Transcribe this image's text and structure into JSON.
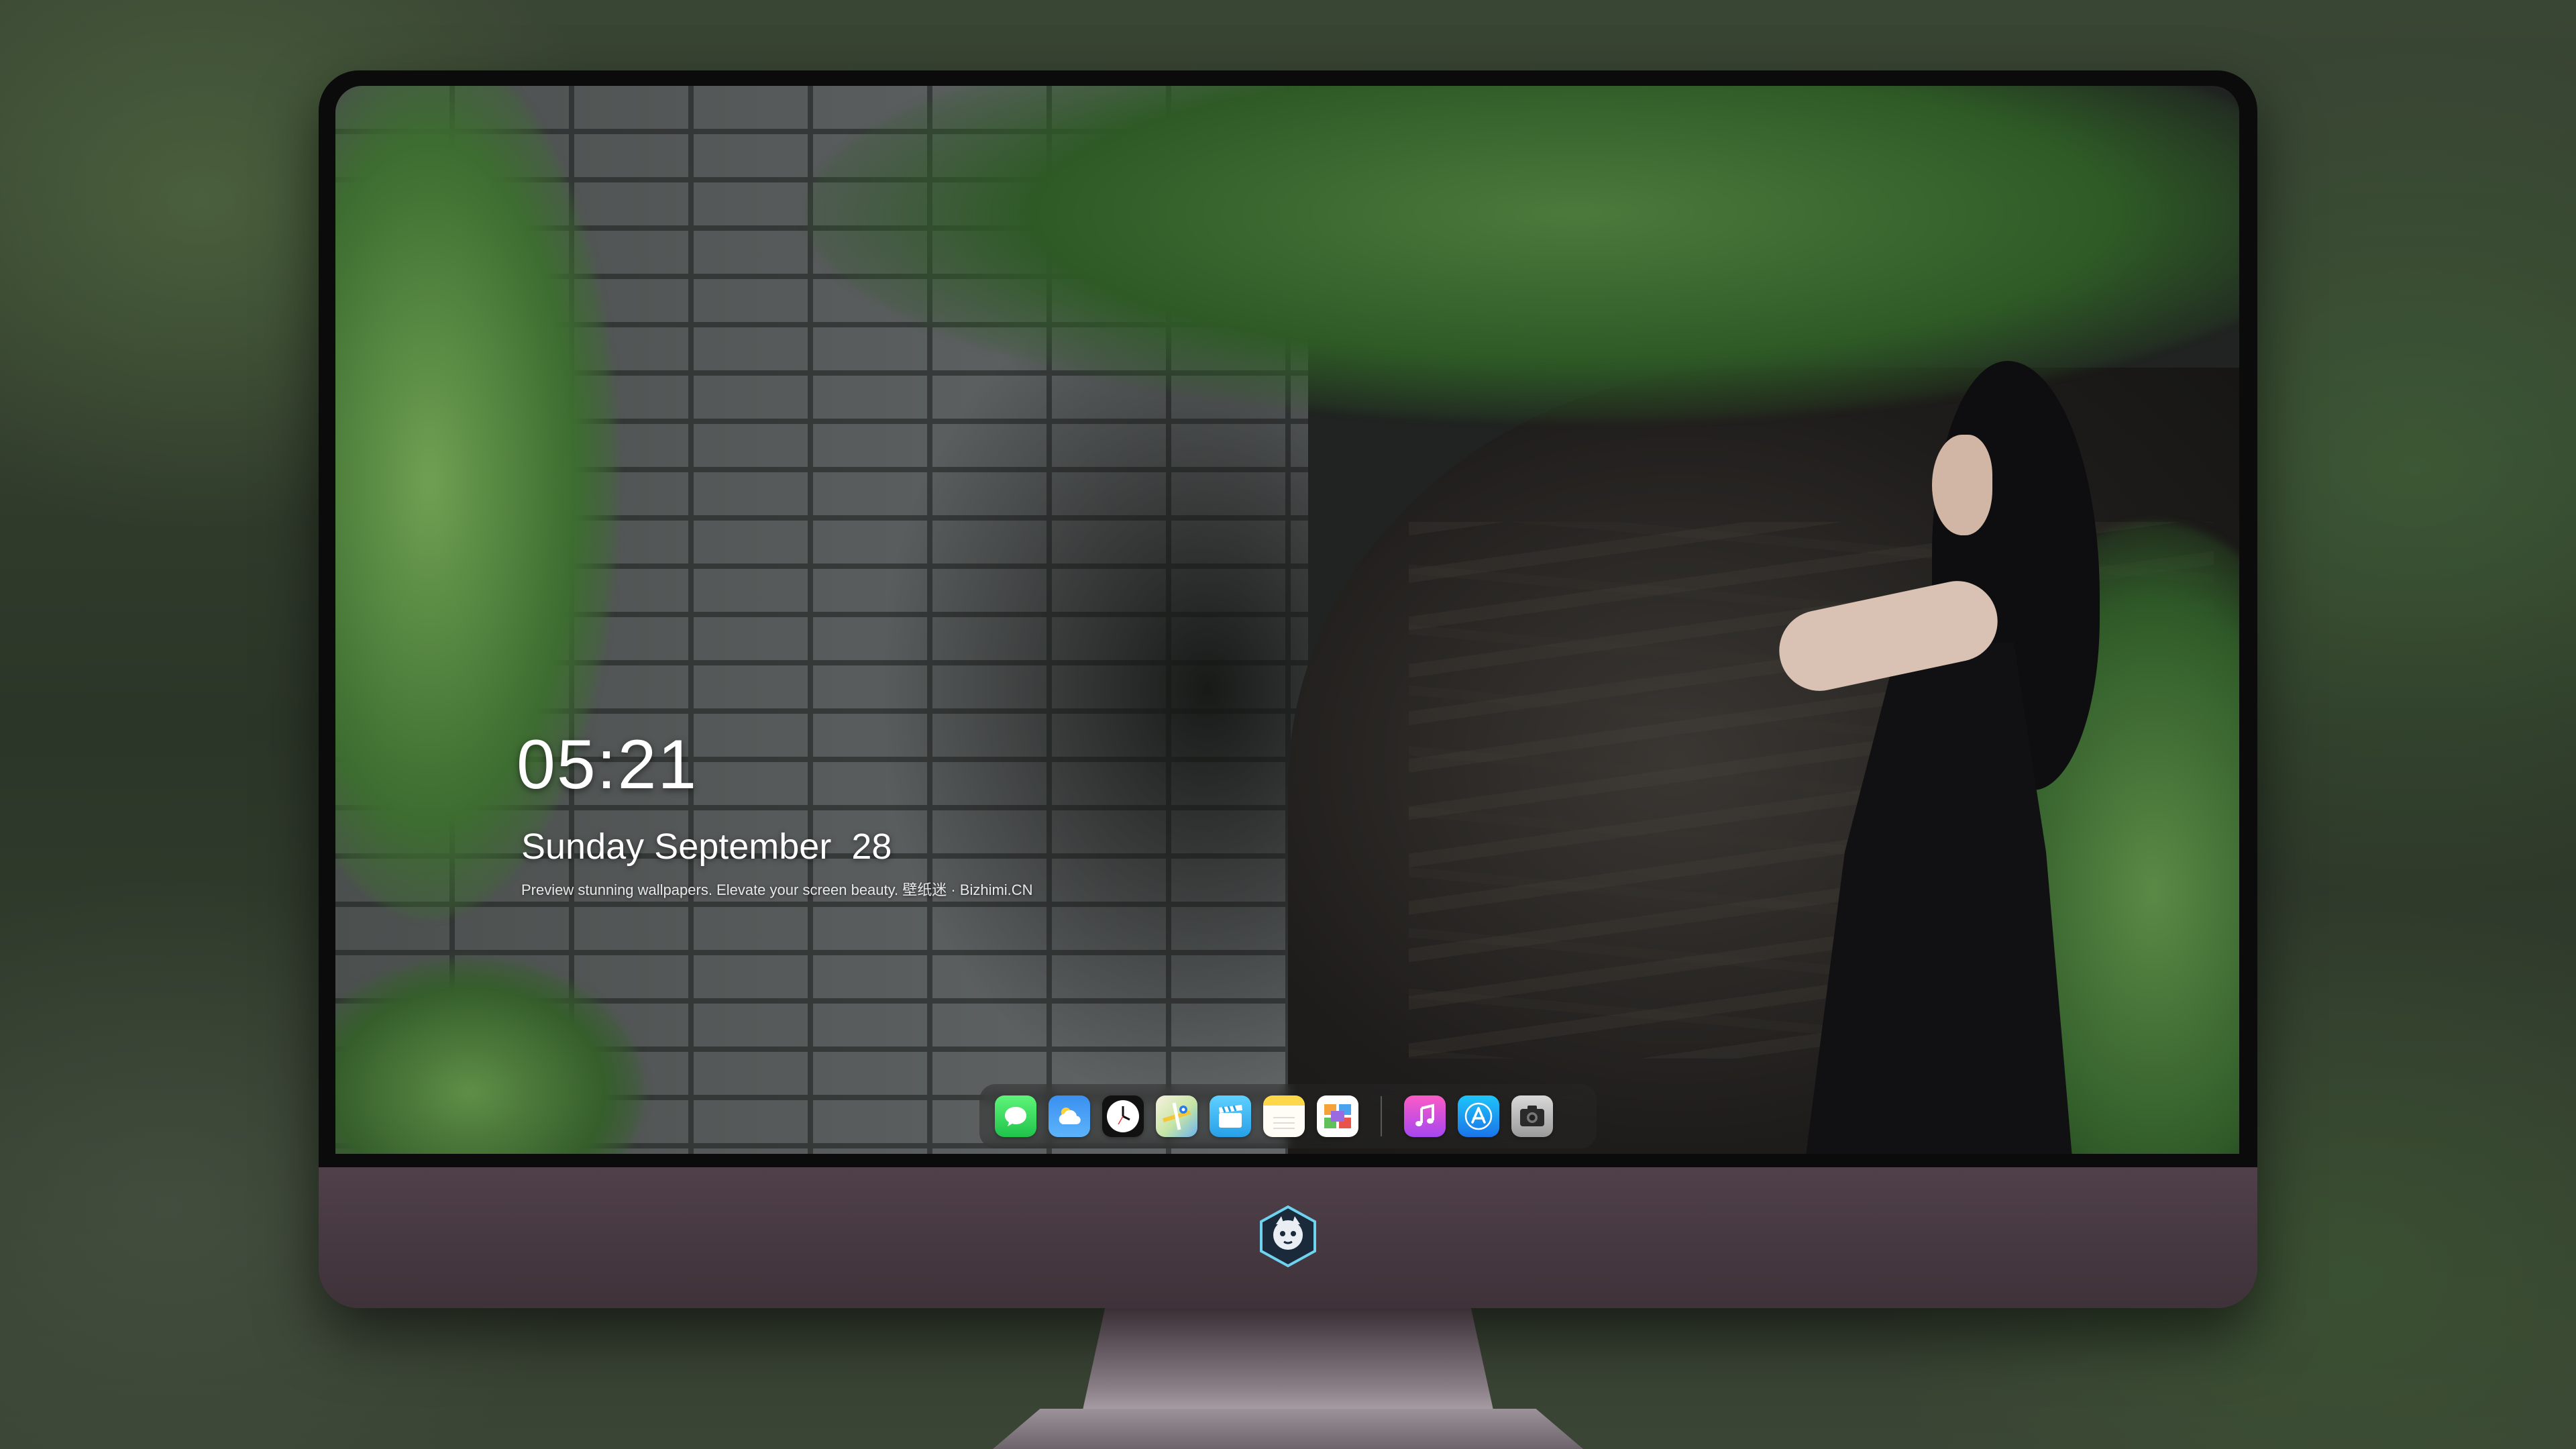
{
  "lockscreen": {
    "time": "05:21",
    "weekday": "Sunday",
    "month": "September",
    "day": "28",
    "tagline": "Preview stunning wallpapers. Elevate your screen beauty. 壁纸迷 · Bizhimi.CN"
  },
  "dock": {
    "apps": [
      {
        "name": "messages",
        "icon": "message-bubble-icon",
        "color": "#2ecc55"
      },
      {
        "name": "weather",
        "icon": "cloud-sun-icon",
        "color": "#3b8ff0"
      },
      {
        "name": "clock",
        "icon": "clock-icon",
        "color": "#111111"
      },
      {
        "name": "maps",
        "icon": "map-icon",
        "color": "#c6e6a5"
      },
      {
        "name": "clips",
        "icon": "clapperboard-icon",
        "color": "#27a0e8"
      },
      {
        "name": "notes",
        "icon": "notepad-icon",
        "color": "#ffd84a"
      },
      {
        "name": "photos",
        "icon": "photo-grid-icon",
        "color": "#ffffff"
      },
      {
        "name": "music",
        "icon": "music-note-icon",
        "color": "#fb5bc5"
      },
      {
        "name": "app-store",
        "icon": "app-store-a-icon",
        "color": "#1a74e8"
      },
      {
        "name": "camera",
        "icon": "camera-icon",
        "color": "#9a9a9a"
      }
    ]
  },
  "device": {
    "chin_logo": "mascot-badge-icon"
  }
}
